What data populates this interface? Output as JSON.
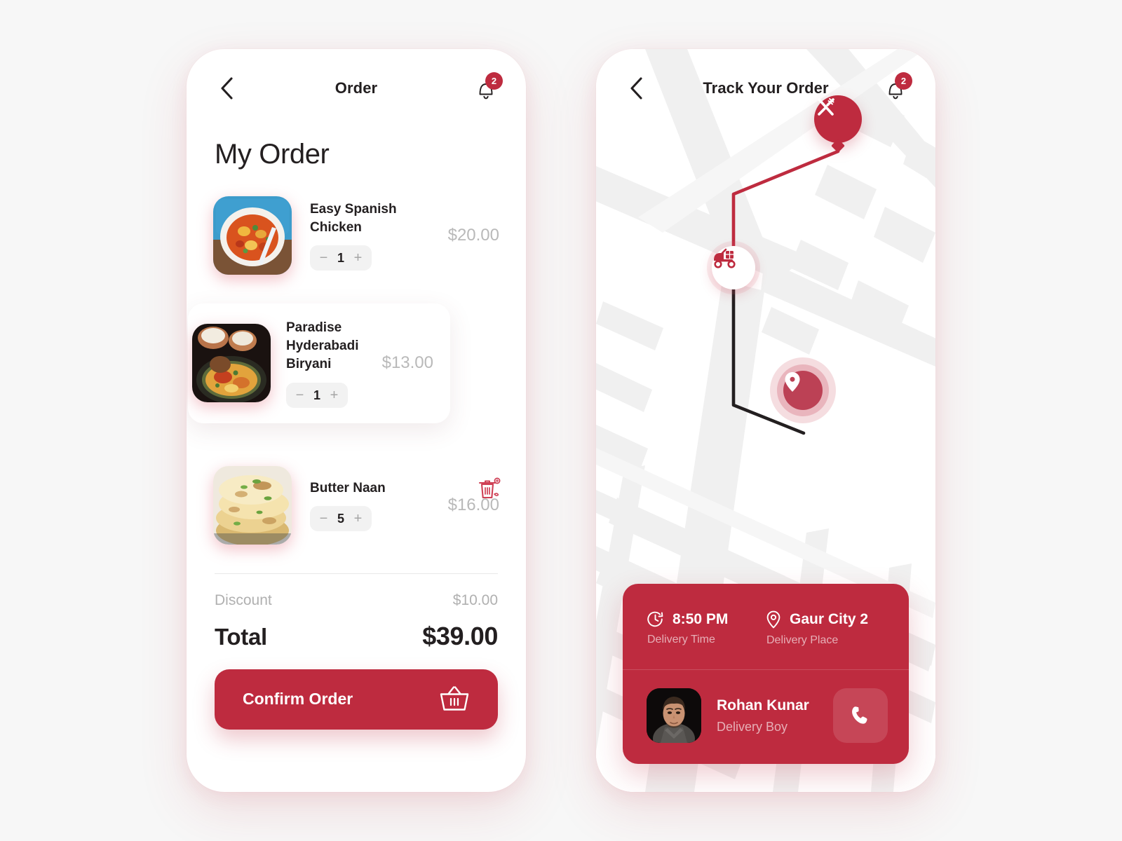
{
  "order_screen": {
    "header": {
      "back_icon": "chevron-left-icon",
      "title": "Order",
      "bell_icon": "bell-icon",
      "badge_count": "2"
    },
    "page_title": "My Order",
    "items": [
      {
        "name": "Easy Spanish Chicken",
        "price": "$20.00",
        "qty": "1",
        "minus": "−",
        "plus": "+",
        "image": "spanish-chicken-photo",
        "swiped": false
      },
      {
        "name": "Paradise Hyderabadi Biryani",
        "price": "$13.00",
        "qty": "1",
        "minus": "−",
        "plus": "+",
        "image": "hyderabadi-biryani-photo",
        "swiped": true,
        "delete_icon": "trash-icon"
      },
      {
        "name": "Butter Naan",
        "price": "$16.00",
        "qty": "5",
        "minus": "−",
        "plus": "+",
        "image": "butter-naan-photo",
        "swiped": false
      }
    ],
    "summary": {
      "discount_label": "Discount",
      "discount_value": "$10.00",
      "total_label": "Total",
      "total_value": "$39.00"
    },
    "confirm_button": {
      "label": "Confirm Order",
      "icon": "shopping-basket-icon"
    }
  },
  "track_screen": {
    "header": {
      "back_icon": "chevron-left-icon",
      "title": "Track Your Order",
      "bell_icon": "bell-icon",
      "badge_count": "2"
    },
    "map": {
      "restaurant_marker_icon": "fork-knife-icon",
      "courier_marker_icon": "delivery-scooter-icon",
      "destination_marker_icon": "location-pin-icon"
    },
    "delivery_card": {
      "time_icon": "clock-icon",
      "time_value": "8:50 PM",
      "time_label": "Delivery Time",
      "place_icon": "location-pin-icon",
      "place_value": "Gaur City 2",
      "place_label": "Delivery Place",
      "courier_avatar": "delivery-boy-photo",
      "courier_name": "Rohan Kunar",
      "courier_role": "Delivery Boy",
      "call_icon": "phone-icon"
    }
  },
  "colors": {
    "brand_red": "#be2b3f",
    "page_background": "#f7f7f7",
    "muted_text": "#b0b0b0",
    "dark_text": "#231f20"
  }
}
